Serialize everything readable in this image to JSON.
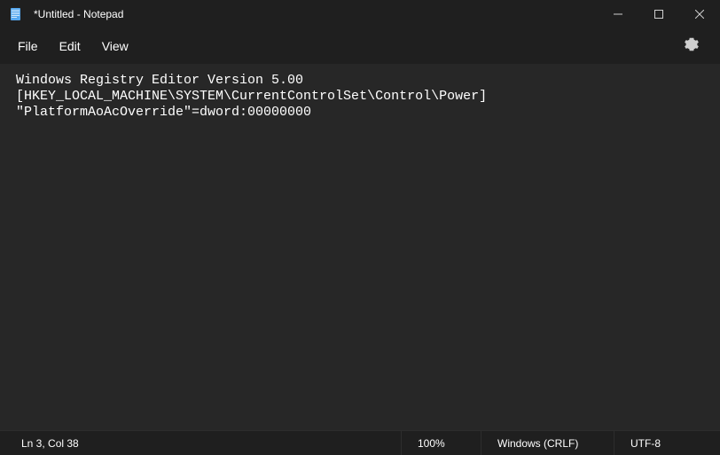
{
  "window": {
    "title": "*Untitled - Notepad"
  },
  "menubar": {
    "items": [
      "File",
      "Edit",
      "View"
    ]
  },
  "editor": {
    "content": "Windows Registry Editor Version 5.00\n[HKEY_LOCAL_MACHINE\\SYSTEM\\CurrentControlSet\\Control\\Power]\n\"PlatformAoAcOverride\"=dword:00000000"
  },
  "statusbar": {
    "position": "Ln 3, Col 38",
    "zoom": "100%",
    "line_ending": "Windows (CRLF)",
    "encoding": "UTF-8"
  }
}
